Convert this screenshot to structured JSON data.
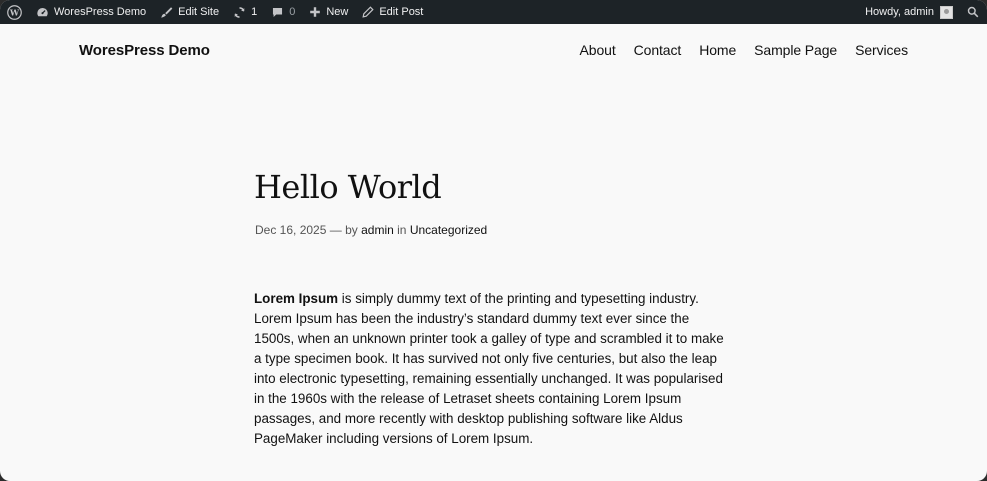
{
  "admin_bar": {
    "site_name": "WoresPress Demo",
    "edit_site": "Edit Site",
    "updates_count": "1",
    "comments_count": "0",
    "new_label": "New",
    "edit_post": "Edit Post",
    "greeting": "Howdy, admin"
  },
  "header": {
    "site_title": "WoresPress Demo",
    "nav": [
      "About",
      "Contact",
      "Home",
      "Sample Page",
      "Services"
    ]
  },
  "post": {
    "title": "Hello World",
    "date": "Dec 16, 2025",
    "dash": "—",
    "by": "by",
    "author": "admin",
    "in": "in",
    "category": "Uncategorized",
    "body_bold": "Lorem Ipsum",
    "body_rest": " is simply dummy text of the printing and typesetting industry. Lorem Ipsum has been the industry’s standard dummy text ever since the 1500s, when an unknown printer took a galley of type and scrambled it to make a type specimen book. It has survived not only five centuries, but also the leap into electronic typesetting, remaining essentially unchanged. It was popularised in the 1960s with the release of Letraset sheets containing Lorem Ipsum passages, and more recently with desktop publishing software like Aldus PageMaker including versions of Lorem Ipsum."
  }
}
